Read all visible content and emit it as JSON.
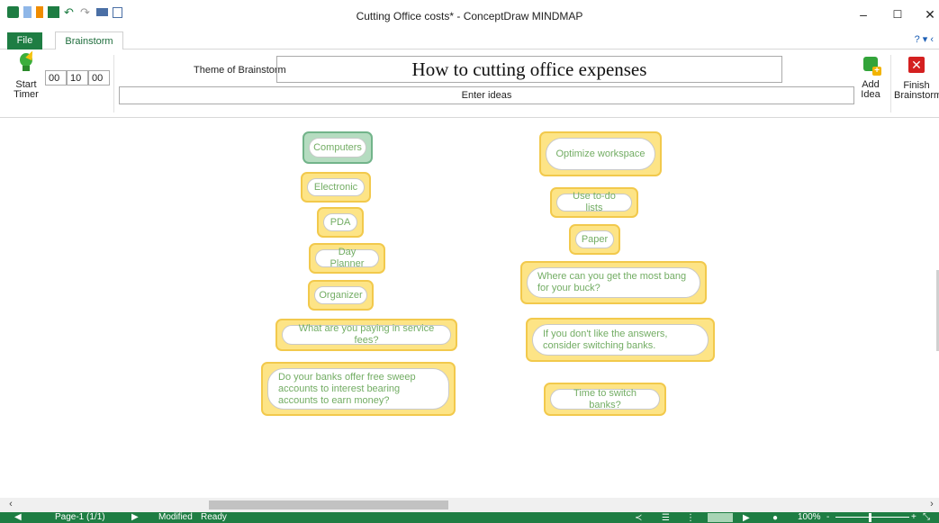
{
  "window": {
    "title": "Cutting Office costs* - ConceptDraw MINDMAP",
    "minimize": "–",
    "maximize": "☐",
    "close": "✕"
  },
  "tabs": {
    "file": "File",
    "brainstorm": "Brainstorm",
    "help": "? ▾ ‹"
  },
  "ribbon": {
    "start_timer": "Start Timer",
    "timer": {
      "hours": "00",
      "minutes": "10",
      "seconds": "00"
    },
    "theme_label": "Theme of Brainstorm",
    "theme_value": "How to cutting office expenses",
    "ideas_placeholder": "Enter ideas",
    "add_idea": "Add Idea",
    "finish_brainstorm": "Finish Brainstorm"
  },
  "ideas": [
    "Computers",
    "Electronic",
    "PDA",
    "Day Planner",
    "Organizer",
    "What are you paying in service fees?",
    "Do your banks offer free sweep accounts to interest bearing accounts to earn money?",
    "Optimize workspace",
    "Use to-do lists",
    "Paper",
    "Where can you get the most bang for your buck?",
    "If you don't like the answers, consider switching banks.",
    "Time to switch banks?"
  ],
  "status": {
    "page": "Page-1 (1/1)",
    "modified": "Modified",
    "ready": "Ready",
    "zoom": "100%",
    "zoom_minus": "-",
    "zoom_plus": "+"
  },
  "colors": {
    "accent_green": "#1e7d43",
    "idea_fill": "#fde486",
    "idea_border": "#f2c94c",
    "selected_fill": "#b5dcc0",
    "idea_text": "#73ad64"
  }
}
